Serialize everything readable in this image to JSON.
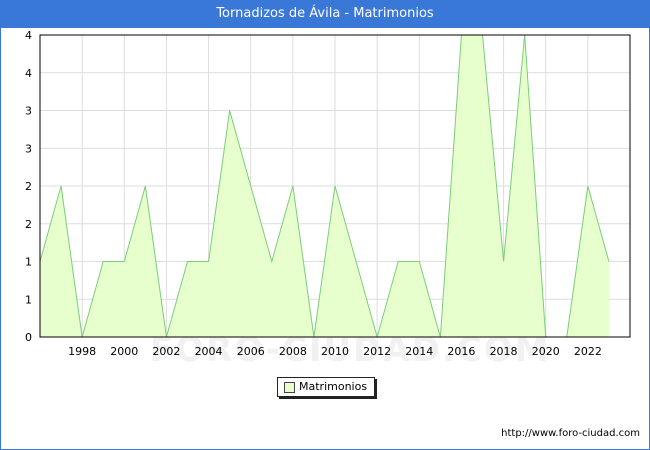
{
  "chart_data": {
    "type": "area",
    "title": "Tornadizos de Ávila - Matrimonios",
    "xlabel": "",
    "ylabel": "",
    "x": [
      1996,
      1997,
      1998,
      1999,
      2000,
      2001,
      2002,
      2003,
      2004,
      2005,
      2006,
      2007,
      2008,
      2009,
      2010,
      2011,
      2012,
      2013,
      2014,
      2015,
      2016,
      2017,
      2018,
      2019,
      2020,
      2021,
      2022,
      2023
    ],
    "series": [
      {
        "name": "Matrimonios",
        "values": [
          1,
          2,
          0,
          1,
          1,
          2,
          0,
          1,
          1,
          3,
          2,
          1,
          2,
          0,
          2,
          1,
          0,
          1,
          1,
          0,
          4,
          4,
          1,
          4,
          0,
          0,
          2,
          1
        ]
      }
    ],
    "xticks": [
      "1998",
      "2000",
      "2002",
      "2004",
      "2006",
      "2008",
      "2010",
      "2012",
      "2014",
      "2016",
      "2018",
      "2020",
      "2022"
    ],
    "ytick_labels": [
      "0",
      "1",
      "1",
      "2",
      "2",
      "3",
      "3",
      "4",
      "4"
    ],
    "ylim": [
      0,
      4
    ],
    "grid": true,
    "legend": "bottom-center",
    "fill_color": "#e6ffcc",
    "line_color": "#7ccc7c"
  },
  "watermark": "FORO-CIUDAD.COM",
  "source": "http://www.foro-ciudad.com"
}
